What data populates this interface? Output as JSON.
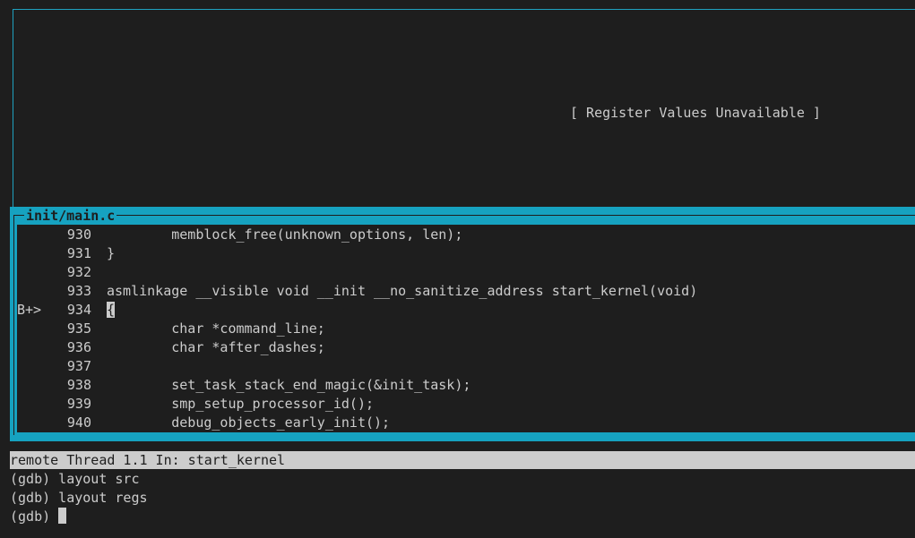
{
  "registers": {
    "message": "[ Register Values Unavailable ]"
  },
  "source": {
    "filename": "init/main.c",
    "lines": [
      {
        "marker": "",
        "number": "930",
        "code": "        memblock_free(unknown_options, len);"
      },
      {
        "marker": "",
        "number": "931",
        "code": "}"
      },
      {
        "marker": "",
        "number": "932",
        "code": ""
      },
      {
        "marker": "",
        "number": "933",
        "code": "asmlinkage __visible void __init __no_sanitize_address start_kernel(void)"
      },
      {
        "marker": "B+>",
        "number": "934",
        "code": "{"
      },
      {
        "marker": "",
        "number": "935",
        "code": "        char *command_line;"
      },
      {
        "marker": "",
        "number": "936",
        "code": "        char *after_dashes;"
      },
      {
        "marker": "",
        "number": "937",
        "code": ""
      },
      {
        "marker": "",
        "number": "938",
        "code": "        set_task_stack_end_magic(&init_task);"
      },
      {
        "marker": "",
        "number": "939",
        "code": "        smp_setup_processor_id();"
      },
      {
        "marker": "",
        "number": "940",
        "code": "        debug_objects_early_init();"
      }
    ]
  },
  "status": {
    "text": "remote Thread 1.1 In: start_kernel"
  },
  "command": {
    "lines": [
      "(gdb) layout src",
      "(gdb) layout regs",
      "(gdb)"
    ]
  },
  "colors": {
    "background": "#1e1e1e",
    "border": "#16a2c0",
    "foreground": "#cccccc"
  }
}
